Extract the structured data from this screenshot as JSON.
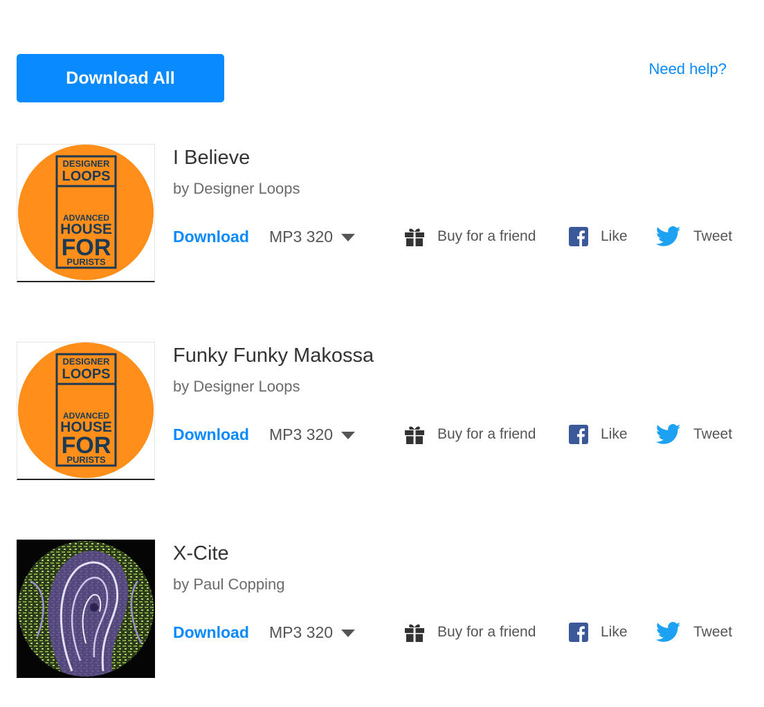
{
  "header": {
    "download_all_label": "Download All",
    "help_label": "Need help?"
  },
  "colors": {
    "accent": "#0a8aff",
    "cover_orange": "#ff8f1a",
    "facebook": "#3b5998",
    "twitter": "#1da1f2"
  },
  "cover_logo_text": [
    "DESIGNER",
    "LOOPS",
    "ADVANCED",
    "HOUSE",
    "FOR",
    "PURISTS"
  ],
  "tracks": [
    {
      "title": "I Believe",
      "artist": "by Designer Loops",
      "download_label": "Download",
      "format": "MP3 320",
      "gift_label": "Buy for a friend",
      "like_label": "Like",
      "tweet_label": "Tweet",
      "cover": "designer-loops-logo"
    },
    {
      "title": "Funky Funky Makossa",
      "artist": "by Designer Loops",
      "download_label": "Download",
      "format": "MP3 320",
      "gift_label": "Buy for a friend",
      "like_label": "Like",
      "tweet_label": "Tweet",
      "cover": "designer-loops-logo"
    },
    {
      "title": "X-Cite",
      "artist": "by Paul Copping",
      "download_label": "Download",
      "format": "MP3 320",
      "gift_label": "Buy for a friend",
      "like_label": "Like",
      "tweet_label": "Tweet",
      "cover": "abstract-face-art"
    }
  ]
}
